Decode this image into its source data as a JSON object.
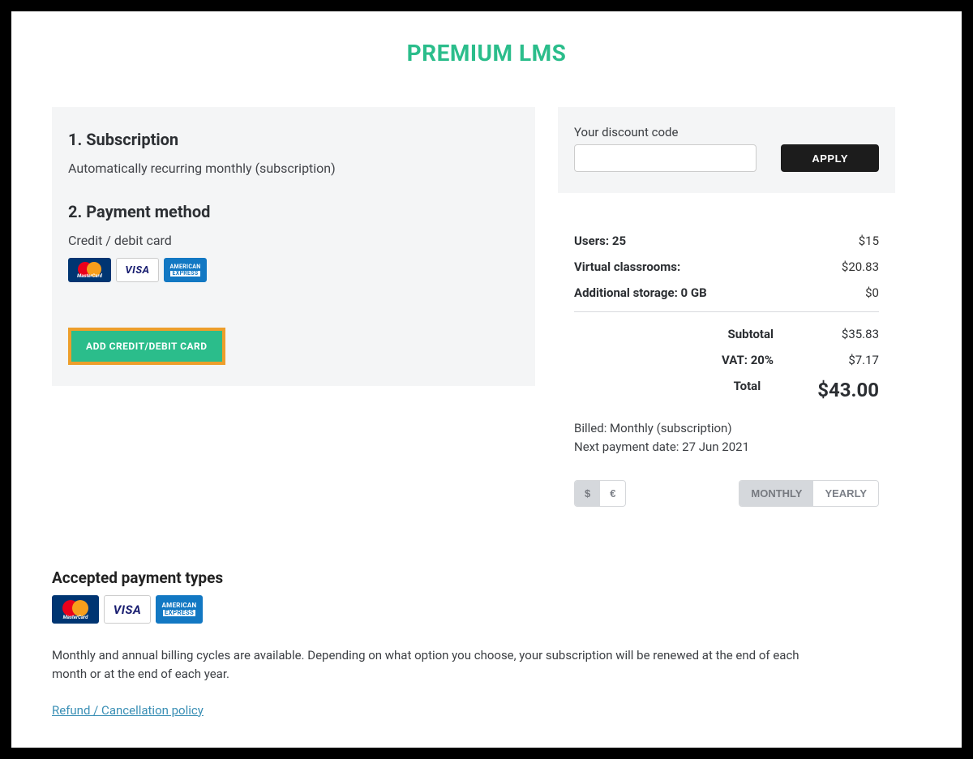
{
  "title": "PREMIUM LMS",
  "left": {
    "step1_heading": "1. Subscription",
    "step1_desc": "Automatically recurring monthly (subscription)",
    "step2_heading": "2. Payment method",
    "card_label": "Credit / debit card",
    "add_card_label": "ADD CREDIT/DEBIT CARD"
  },
  "discount": {
    "label": "Your discount code",
    "value": "",
    "apply_label": "APPLY"
  },
  "summary": {
    "items": {
      "users": {
        "label": "Users: 25",
        "value": "$15"
      },
      "virtual_classrooms": {
        "label": "Virtual classrooms:",
        "value": "$20.83"
      },
      "storage": {
        "label": "Additional storage: 0 GB",
        "value": "$0"
      }
    },
    "subtotal": {
      "label": "Subtotal",
      "value": "$35.83"
    },
    "vat": {
      "label": "VAT: 20%",
      "value": "$7.17"
    },
    "total": {
      "label": "Total",
      "value": "$43.00"
    },
    "billed": "Billed: Monthly (subscription)",
    "next_payment": "Next payment date: 27 Jun 2021",
    "currency": {
      "usd": "$",
      "eur": "€",
      "active": "usd"
    },
    "period": {
      "monthly": "MONTHLY",
      "yearly": "YEARLY",
      "active": "monthly"
    }
  },
  "footer": {
    "accepted_title": "Accepted payment types",
    "note": "Monthly and annual billing cycles are available. Depending on what option you choose, your subscription will be renewed at the end of each month or at the end of each year.",
    "refund_link": "Refund / Cancellation policy"
  },
  "card_brands": {
    "mastercard": "MasterCard",
    "visa": "VISA",
    "amex_line1": "AMERICAN",
    "amex_line2": "EXPRESS"
  }
}
